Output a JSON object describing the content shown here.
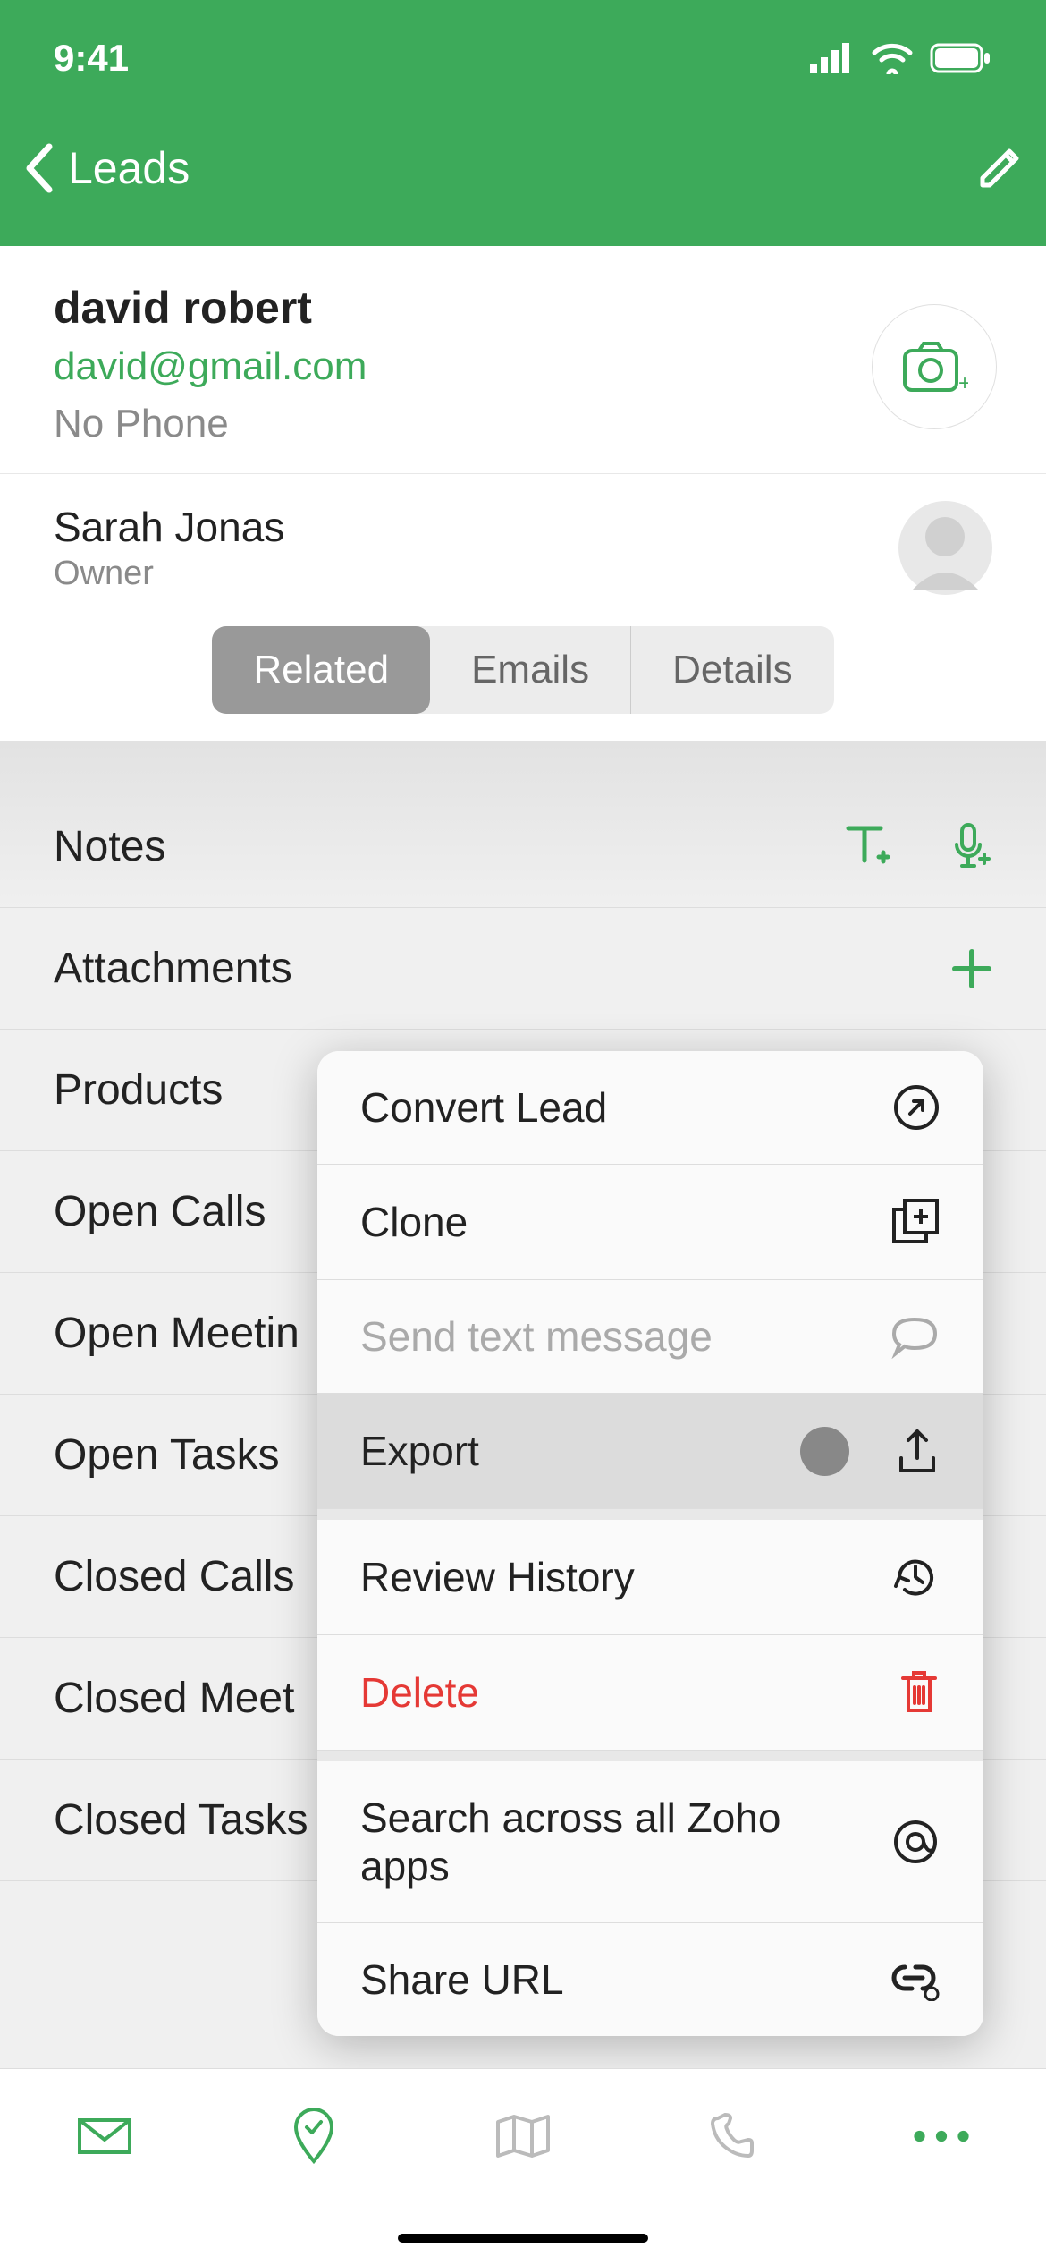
{
  "status": {
    "time": "9:41"
  },
  "nav": {
    "back_label": "Leads"
  },
  "lead": {
    "name": "david robert",
    "email": "david@gmail.com",
    "phone_label": "No Phone"
  },
  "owner": {
    "name": "Sarah Jonas",
    "role": "Owner"
  },
  "tabs": {
    "related": "Related",
    "emails": "Emails",
    "details": "Details"
  },
  "related": {
    "notes": "Notes",
    "attachments": "Attachments",
    "products": "Products",
    "open_calls": "Open Calls",
    "open_meetings": "Open Meetin",
    "open_tasks": "Open Tasks",
    "closed_calls": "Closed Calls",
    "closed_meetings": "Closed Meet",
    "closed_tasks": "Closed Tasks"
  },
  "popover": {
    "convert": "Convert Lead",
    "clone": "Clone",
    "sms": "Send text message",
    "export": "Export",
    "review": "Review History",
    "delete": "Delete",
    "search": "Search across all Zoho apps",
    "share": "Share URL"
  }
}
